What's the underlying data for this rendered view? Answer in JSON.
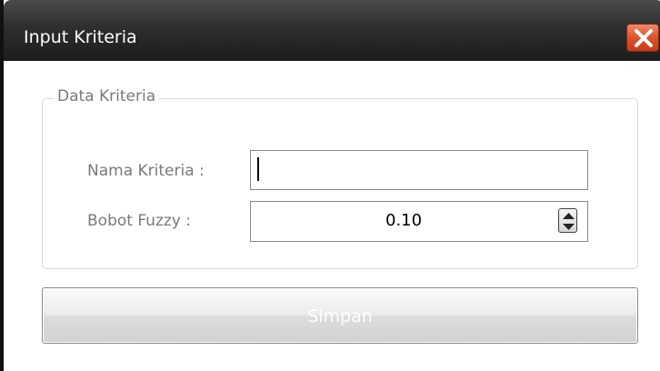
{
  "window": {
    "title": "Input Kriteria"
  },
  "group": {
    "legend": "Data Kriteria"
  },
  "form": {
    "name_label": "Nama Kriteria :",
    "name_value": "",
    "fuzzy_label": "Bobot Fuzzy :",
    "fuzzy_value": "0.10"
  },
  "actions": {
    "save_label": "Simpan"
  },
  "colors": {
    "titlebar": "#2e2e2e",
    "close_button": "#e0562f",
    "label_text": "#7a7a7a",
    "disabled_button_text": "#ffffff"
  },
  "icons": {
    "close": "close-icon",
    "spin": "spin-arrows-icon"
  }
}
